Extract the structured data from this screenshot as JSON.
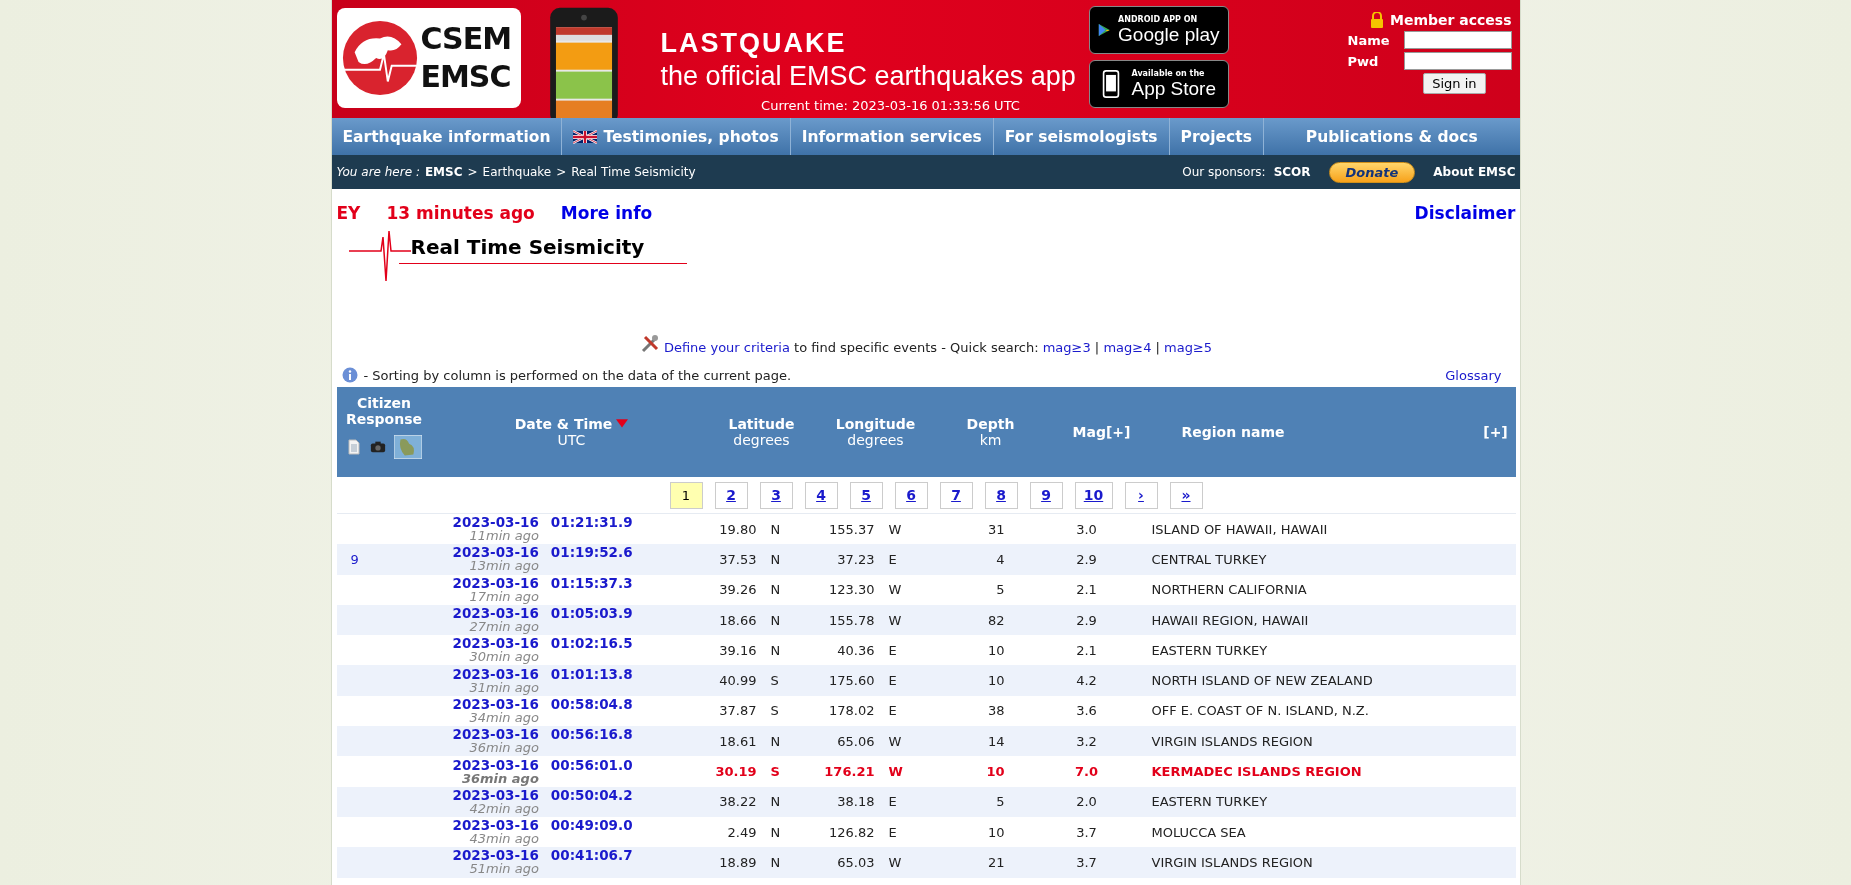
{
  "logo": {
    "top": "CSEM",
    "bottom": "EMSC"
  },
  "banner": {
    "kind": "picture",
    "title": "LASTQUAKE",
    "subtitle": "the official EMSC earthquakes app",
    "current_time": "Current time: 2023-03-16 01:33:56 UTC"
  },
  "store_badges": [
    {
      "kind": "play",
      "small": "ANDROID APP ON",
      "big": "Google play"
    },
    {
      "kind": "apple",
      "small": "Available on the",
      "big": "App Store"
    }
  ],
  "member": {
    "title": "Member access",
    "name_label": "Name",
    "pwd_label": "Pwd",
    "button": "Sign in"
  },
  "nav": [
    {
      "label": "Earthquake information",
      "flag": false
    },
    {
      "label": "Testimonies, photos",
      "flag": true
    },
    {
      "label": "Information services",
      "flag": false
    },
    {
      "label": "For seismologists",
      "flag": false
    },
    {
      "label": "Projects",
      "flag": false
    },
    {
      "label": "Publications & docs",
      "flag": false
    }
  ],
  "breadcrumb": {
    "prefix": "You are here :",
    "separator": ">",
    "items": [
      {
        "label": "EMSC",
        "bold": true
      },
      {
        "label": "Earthquake",
        "bold": false
      },
      {
        "label": "Real Time Seismicity",
        "bold": false
      }
    ]
  },
  "sponsors": {
    "label": "Our sponsors:",
    "name": "SCOR",
    "donate": "Donate",
    "about": "About EMSC"
  },
  "ticker": {
    "cut_text": "EY",
    "age": "13 minutes ago",
    "more": "More info",
    "disclaimer": "Disclaimer"
  },
  "title": "Real Time Seismicity",
  "criteria": {
    "link": "Define your criteria",
    "text": "to find specific events - Quick search:",
    "separator": "|",
    "quick": [
      "mag≥3",
      "mag≥4",
      "mag≥5"
    ]
  },
  "note": {
    "text": "- Sorting by column is performed on the data of the current page.",
    "glossary": "Glossary"
  },
  "columns": [
    {
      "title": "Citizen Response",
      "sorted": false
    },
    {
      "title": "Date & Time",
      "sub": "UTC",
      "sorted": true
    },
    {
      "title": "Latitude",
      "sub": "degrees",
      "sorted": false
    },
    {
      "title": "Longitude",
      "sub": "degrees",
      "sorted": false
    },
    {
      "title": "Depth",
      "sub": "km",
      "sorted": false
    },
    {
      "title": "Mag[+]",
      "sorted": false
    },
    {
      "title": "Region name",
      "sorted": false
    },
    {
      "title": "[+]",
      "sorted": false
    }
  ],
  "pages": [
    {
      "label": "1",
      "selected": true
    },
    {
      "label": "2",
      "selected": false
    },
    {
      "label": "3",
      "selected": false
    },
    {
      "label": "4",
      "selected": false
    },
    {
      "label": "5",
      "selected": false
    },
    {
      "label": "6",
      "selected": false
    },
    {
      "label": "7",
      "selected": false
    },
    {
      "label": "8",
      "selected": false
    },
    {
      "label": "9",
      "selected": false
    },
    {
      "label": "10",
      "selected": false
    },
    {
      "label": "›",
      "selected": false
    },
    {
      "label": "»",
      "selected": false
    }
  ],
  "rows": [
    {
      "citizen": "",
      "date": "2023-03-16",
      "time": "01:21:31.9",
      "ago": "11min ago",
      "lat": "19.80",
      "lat_dir": "N",
      "lon": "155.37",
      "lon_dir": "W",
      "depth": "31",
      "mag": "3.0",
      "region": "ISLAND OF HAWAII, HAWAII",
      "highlight": false
    },
    {
      "citizen": "9",
      "date": "2023-03-16",
      "time": "01:19:52.6",
      "ago": "13min ago",
      "lat": "37.53",
      "lat_dir": "N",
      "lon": "37.23",
      "lon_dir": "E",
      "depth": "4",
      "mag": "2.9",
      "region": "CENTRAL TURKEY",
      "highlight": false
    },
    {
      "citizen": "",
      "date": "2023-03-16",
      "time": "01:15:37.3",
      "ago": "17min ago",
      "lat": "39.26",
      "lat_dir": "N",
      "lon": "123.30",
      "lon_dir": "W",
      "depth": "5",
      "mag": "2.1",
      "region": "NORTHERN CALIFORNIA",
      "highlight": false
    },
    {
      "citizen": "",
      "date": "2023-03-16",
      "time": "01:05:03.9",
      "ago": "27min ago",
      "lat": "18.66",
      "lat_dir": "N",
      "lon": "155.78",
      "lon_dir": "W",
      "depth": "82",
      "mag": "2.9",
      "region": "HAWAII REGION, HAWAII",
      "highlight": false
    },
    {
      "citizen": "",
      "date": "2023-03-16",
      "time": "01:02:16.5",
      "ago": "30min ago",
      "lat": "39.16",
      "lat_dir": "N",
      "lon": "40.36",
      "lon_dir": "E",
      "depth": "10",
      "mag": "2.1",
      "region": "EASTERN TURKEY",
      "highlight": false
    },
    {
      "citizen": "",
      "date": "2023-03-16",
      "time": "01:01:13.8",
      "ago": "31min ago",
      "lat": "40.99",
      "lat_dir": "S",
      "lon": "175.60",
      "lon_dir": "E",
      "depth": "10",
      "mag": "4.2",
      "region": "NORTH ISLAND OF NEW ZEALAND",
      "highlight": false
    },
    {
      "citizen": "",
      "date": "2023-03-16",
      "time": "00:58:04.8",
      "ago": "34min ago",
      "lat": "37.87",
      "lat_dir": "S",
      "lon": "178.02",
      "lon_dir": "E",
      "depth": "38",
      "mag": "3.6",
      "region": "OFF E. COAST OF N. ISLAND, N.Z.",
      "highlight": false
    },
    {
      "citizen": "",
      "date": "2023-03-16",
      "time": "00:56:16.8",
      "ago": "36min ago",
      "lat": "18.61",
      "lat_dir": "N",
      "lon": "65.06",
      "lon_dir": "W",
      "depth": "14",
      "mag": "3.2",
      "region": "VIRGIN ISLANDS REGION",
      "highlight": false
    },
    {
      "citizen": "",
      "date": "2023-03-16",
      "time": "00:56:01.0",
      "ago": "36min ago",
      "lat": "30.19",
      "lat_dir": "S",
      "lon": "176.21",
      "lon_dir": "W",
      "depth": "10",
      "mag": "7.0",
      "region": "KERMADEC ISLANDS REGION",
      "highlight": true
    },
    {
      "citizen": "",
      "date": "2023-03-16",
      "time": "00:50:04.2",
      "ago": "42min ago",
      "lat": "38.22",
      "lat_dir": "N",
      "lon": "38.18",
      "lon_dir": "E",
      "depth": "5",
      "mag": "2.0",
      "region": "EASTERN TURKEY",
      "highlight": false
    },
    {
      "citizen": "",
      "date": "2023-03-16",
      "time": "00:49:09.0",
      "ago": "43min ago",
      "lat": "2.49",
      "lat_dir": "N",
      "lon": "126.82",
      "lon_dir": "E",
      "depth": "10",
      "mag": "3.7",
      "region": "MOLUCCA SEA",
      "highlight": false
    },
    {
      "citizen": "",
      "date": "2023-03-16",
      "time": "00:41:06.7",
      "ago": "51min ago",
      "lat": "18.89",
      "lat_dir": "N",
      "lon": "65.03",
      "lon_dir": "W",
      "depth": "21",
      "mag": "3.7",
      "region": "VIRGIN ISLANDS REGION",
      "highlight": false
    }
  ]
}
